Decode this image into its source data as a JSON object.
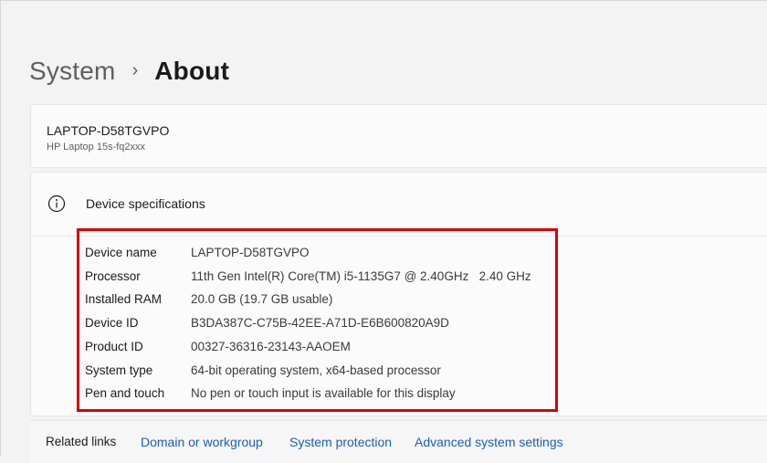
{
  "breadcrumb": {
    "parent": "System",
    "separator": "›",
    "current": "About"
  },
  "device": {
    "hostname": "LAPTOP-D58TGVPO",
    "model": "HP Laptop 15s-fq2xxx"
  },
  "specs": {
    "icon": "info-icon",
    "title": "Device specifications",
    "highlight_color": "#d90000",
    "rows": [
      {
        "label": "Device name",
        "value": "LAPTOP-D58TGVPO"
      },
      {
        "label": "Processor",
        "value": "11th Gen Intel(R) Core(TM) i5-1135G7 @ 2.40GHz   2.40 GHz"
      },
      {
        "label": "Installed RAM",
        "value": "20.0 GB (19.7 GB usable)"
      },
      {
        "label": "Device ID",
        "value": "B3DA387C-C75B-42EE-A71D-E6B600820A9D"
      },
      {
        "label": "Product ID",
        "value": "00327-36316-23143-AAOEM"
      },
      {
        "label": "System type",
        "value": "64-bit operating system, x64-based processor"
      },
      {
        "label": "Pen and touch",
        "value": "No pen or touch input is available for this display"
      }
    ]
  },
  "related": {
    "label": "Related links",
    "link_color": "#1a5fb4",
    "links": [
      {
        "label": "Domain or workgroup"
      },
      {
        "label": "System protection"
      },
      {
        "label": "Advanced system settings"
      }
    ]
  }
}
